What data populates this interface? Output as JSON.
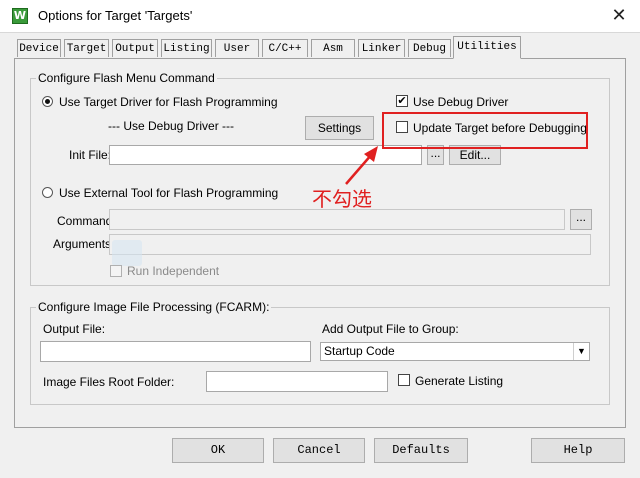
{
  "window": {
    "title": "Options for Target 'Targets'",
    "app_icon_letter": "W",
    "close_glyph": "✕"
  },
  "tabs": [
    {
      "label": "Device"
    },
    {
      "label": "Target"
    },
    {
      "label": "Output"
    },
    {
      "label": "Listing"
    },
    {
      "label": "User"
    },
    {
      "label": "C/C++"
    },
    {
      "label": "Asm"
    },
    {
      "label": "Linker"
    },
    {
      "label": "Debug"
    },
    {
      "label": "Utilities",
      "active": true
    }
  ],
  "flash_group": {
    "title": "Configure Flash Menu Command",
    "use_target_driver": {
      "label": "Use Target Driver for Flash Programming",
      "selected": true
    },
    "use_debug_driver_text": "--- Use Debug Driver ---",
    "settings_button": "Settings",
    "use_debug_driver_check": {
      "label": "Use Debug Driver",
      "checked": true,
      "mark": "✔"
    },
    "update_target_check": {
      "label": "Update Target before Debugging",
      "checked": false
    },
    "init_file": {
      "label": "Init File:",
      "value": "",
      "browse": "...",
      "edit": "Edit..."
    },
    "use_external_tool": {
      "label": "Use External Tool for Flash Programming",
      "selected": false
    },
    "command": {
      "label": "Command:",
      "value": "",
      "browse": "..."
    },
    "arguments": {
      "label": "Arguments:",
      "value": ""
    },
    "run_independent": {
      "label": "Run Independent",
      "checked": false
    }
  },
  "image_group": {
    "title": "Configure Image File Processing (FCARM):",
    "output_file": {
      "label": "Output File:",
      "value": ""
    },
    "add_output_group": {
      "label": "Add Output File  to Group:",
      "value": "Startup Code",
      "arrow": "▼"
    },
    "root_folder": {
      "label": "Image Files Root Folder:",
      "value": ""
    },
    "generate_listing": {
      "label": "Generate Listing",
      "checked": false
    }
  },
  "buttons": {
    "ok": "OK",
    "cancel": "Cancel",
    "defaults": "Defaults",
    "help": "Help"
  },
  "annotation": {
    "text": "不勾选",
    "color": "#e02020"
  }
}
